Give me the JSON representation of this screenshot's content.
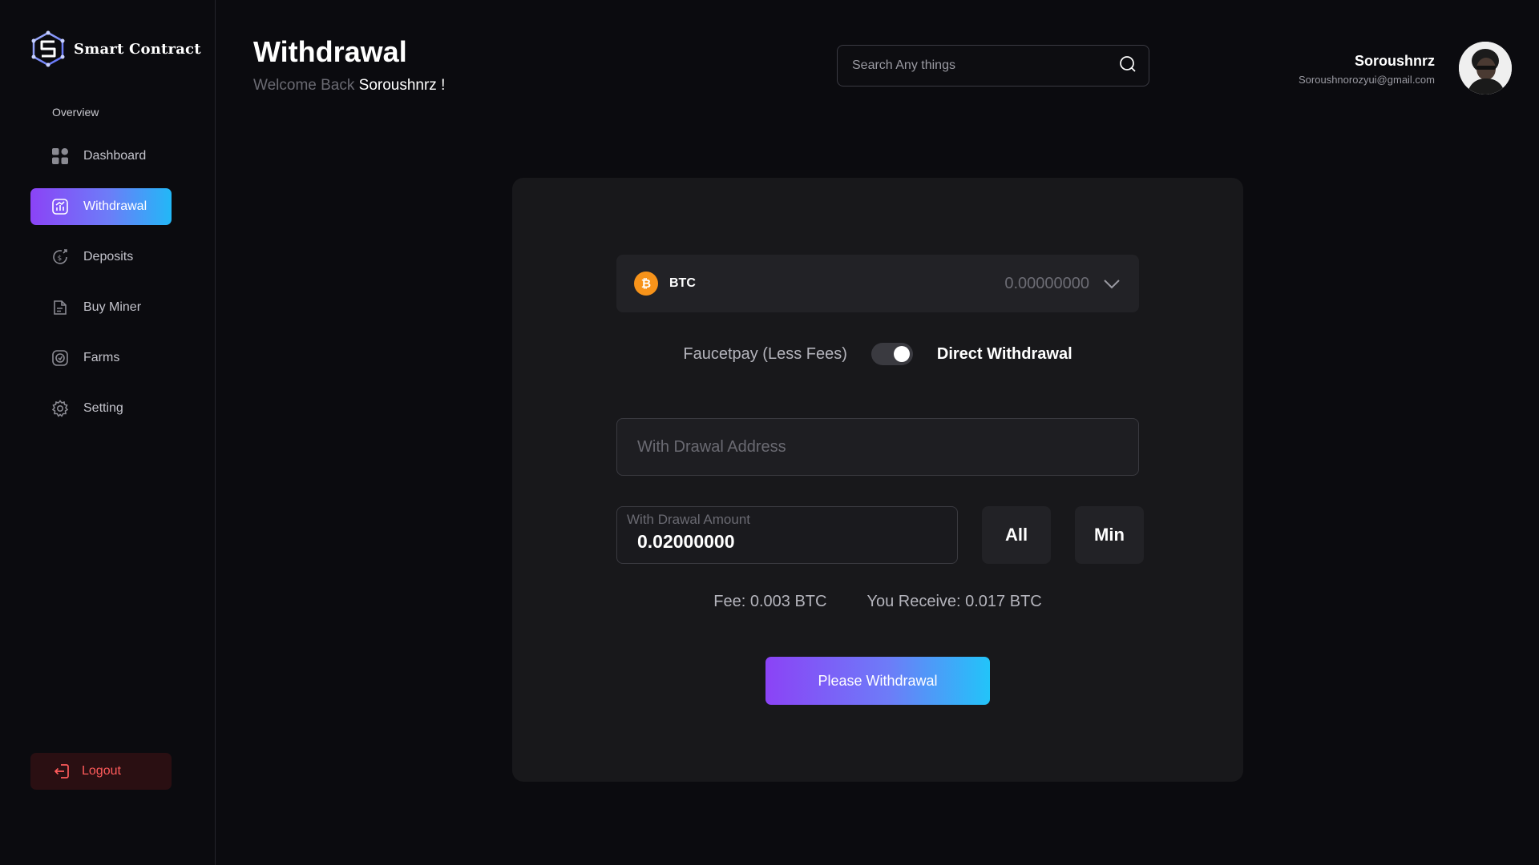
{
  "brand": {
    "name": "Smart Contract",
    "icon": "smart-contract-logo"
  },
  "sidebar": {
    "section_label": "Overview",
    "items": [
      {
        "label": "Dashboard",
        "icon": "grid-icon",
        "active": false
      },
      {
        "label": "Withdrawal",
        "icon": "chart-icon",
        "active": true
      },
      {
        "label": "Deposits",
        "icon": "dollar-cycle-icon",
        "active": false
      },
      {
        "label": "Buy Miner",
        "icon": "document-icon",
        "active": false
      },
      {
        "label": "Farms",
        "icon": "farm-icon",
        "active": false
      },
      {
        "label": "Setting",
        "icon": "gear-icon",
        "active": false
      }
    ],
    "logout_label": "Logout"
  },
  "header": {
    "title": "Withdrawal",
    "welcome_prefix": "Welcome Back",
    "welcome_name": "Soroushnrz !",
    "search_placeholder": "Search Any things",
    "user_name": "Soroushnrz",
    "user_email": "Soroushnorozyui@gmail.com"
  },
  "withdraw": {
    "coin": {
      "symbol": "BTC",
      "icon_glyph": "₿",
      "balance": "0.00000000"
    },
    "toggle": {
      "left_label": "Faucetpay (Less Fees)",
      "right_label": "Direct Withdrawal",
      "on": true
    },
    "address_placeholder": "With Drawal Address",
    "amount_label": "With Drawal Amount",
    "amount_value": "0.02000000",
    "all_label": "All",
    "min_label": "Min",
    "fee_text": "Fee: 0.003 BTC",
    "receive_text": "You Receive: 0.017 BTC",
    "submit_label": "Please Withdrawal"
  },
  "colors": {
    "background": "#0b0b0f",
    "card": "#18181b",
    "accent_start": "#8b43f6",
    "accent_end": "#22b8f7",
    "logout_text": "#ff5b5b",
    "btc": "#f7931a"
  }
}
